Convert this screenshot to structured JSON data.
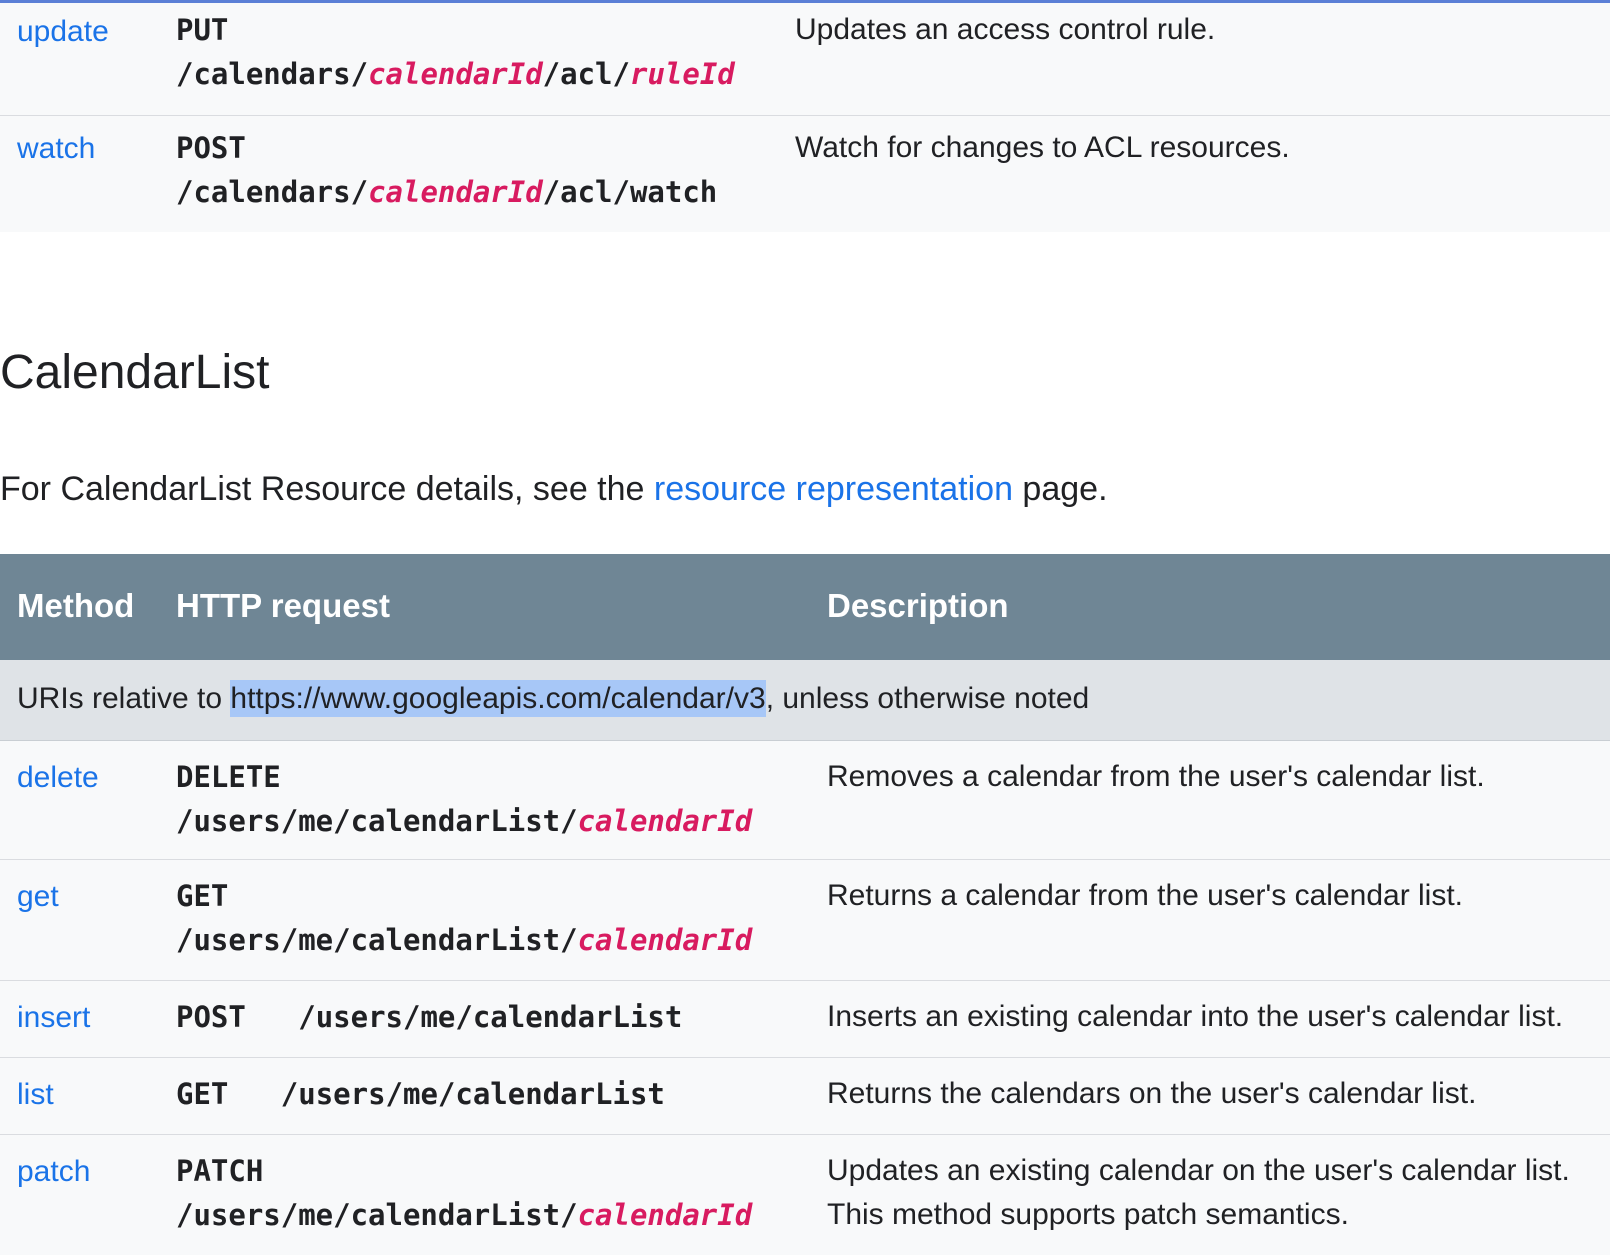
{
  "acl_rows": [
    {
      "method": "update",
      "verb": "PUT",
      "path": [
        {
          "t": "/calendars/"
        },
        {
          "t": "calendarId",
          "p": true
        },
        {
          "t": "/acl/"
        },
        {
          "t": "ruleId",
          "p": true
        }
      ],
      "description": "Updates an access control rule."
    },
    {
      "method": "watch",
      "verb": "POST",
      "path": [
        {
          "t": "/calendars/"
        },
        {
          "t": "calendarId",
          "p": true
        },
        {
          "t": "/acl/watch"
        }
      ],
      "description": "Watch for changes to ACL resources."
    }
  ],
  "section": {
    "title": "CalendarList",
    "intro_before": "For CalendarList Resource details, see the ",
    "intro_link": "resource representation",
    "intro_after": " page."
  },
  "table": {
    "headers": {
      "method": "Method",
      "request": "HTTP request",
      "description": "Description"
    },
    "uri_prefix": "URIs relative to ",
    "uri_link": "https://www.googleapis.com/calendar/v3",
    "uri_suffix": ", unless otherwise noted",
    "rows": [
      {
        "method": "delete",
        "verb": "DELETE",
        "path": [
          {
            "t": "/users/me/calendarList/"
          },
          {
            "t": "calendarId",
            "p": true
          }
        ],
        "description": "Removes a calendar from the user's calendar list."
      },
      {
        "method": "get",
        "verb": "GET",
        "path": [
          {
            "t": "/users/me/calendarList/"
          },
          {
            "t": "calendarId",
            "p": true
          }
        ],
        "description": "Returns a calendar from the user's calendar list."
      },
      {
        "method": "insert",
        "verb": "POST",
        "path": [
          {
            "t": "/users/me/calendarList"
          }
        ],
        "description": "Inserts an existing calendar into the user's calendar list.",
        "inline": true
      },
      {
        "method": "list",
        "verb": "GET",
        "path": [
          {
            "t": "/users/me/calendarList"
          }
        ],
        "description": "Returns the calendars on the user's calendar list.",
        "inline": true
      },
      {
        "method": "patch",
        "verb": "PATCH",
        "path": [
          {
            "t": "/users/me/calendarList/"
          },
          {
            "t": "calendarId",
            "p": true
          }
        ],
        "description": "Updates an existing calendar on the user's calendar list. This method supports patch semantics."
      }
    ]
  }
}
